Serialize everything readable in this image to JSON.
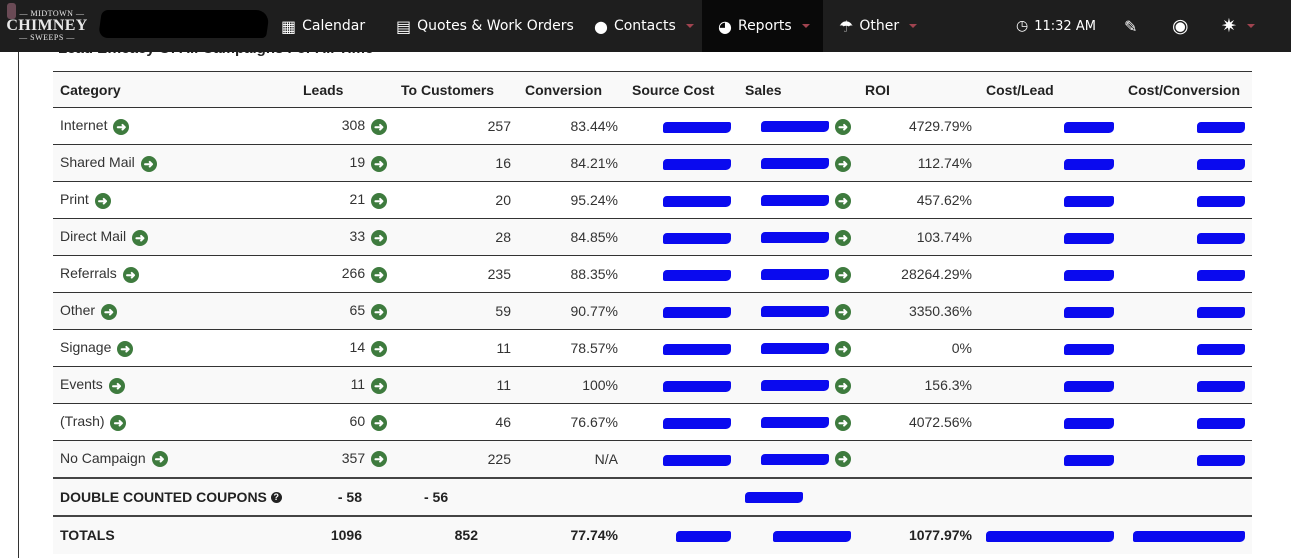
{
  "nav": {
    "logo": {
      "line1": "— MIDTOWN —",
      "line2": "CHIMNEY",
      "line3": "— SWEEPS —"
    },
    "items": [
      {
        "label": "Calendar",
        "icon": "calendar-icon",
        "glyph": "▦",
        "dropdown": false
      },
      {
        "label": "Quotes & Work Orders",
        "icon": "book-icon",
        "glyph": "▤",
        "dropdown": false
      },
      {
        "label": "Contacts",
        "icon": "user-icon",
        "glyph": "●",
        "dropdown": true
      },
      {
        "label": "Reports",
        "icon": "pie-chart-icon",
        "glyph": "◕",
        "dropdown": true,
        "active": true
      },
      {
        "label": "Other",
        "icon": "umbrella-icon",
        "glyph": "☂",
        "dropdown": true
      }
    ],
    "time": "11:32 AM",
    "clock_glyph": "◷",
    "edit_glyph": "✎",
    "globe_glyph": "◉",
    "gear_glyph": "✷"
  },
  "report": {
    "title": "Lead Efficacy Of All Campaigns For All Time",
    "columns": [
      "Category",
      "Leads",
      "To Customers",
      "Conversion",
      "Source Cost",
      "Sales",
      "ROI",
      "Cost/Lead",
      "Cost/Conversion"
    ],
    "rows": [
      {
        "category": "Internet",
        "leads": "308",
        "customers": "257",
        "conversion": "83.44%",
        "roi": "4729.79%"
      },
      {
        "category": "Shared Mail",
        "leads": "19",
        "customers": "16",
        "conversion": "84.21%",
        "roi": "112.74%"
      },
      {
        "category": "Print",
        "leads": "21",
        "customers": "20",
        "conversion": "95.24%",
        "roi": "457.62%"
      },
      {
        "category": "Direct Mail",
        "leads": "33",
        "customers": "28",
        "conversion": "84.85%",
        "roi": "103.74%"
      },
      {
        "category": "Referrals",
        "leads": "266",
        "customers": "235",
        "conversion": "88.35%",
        "roi": "28264.29%"
      },
      {
        "category": "Other",
        "leads": "65",
        "customers": "59",
        "conversion": "90.77%",
        "roi": "3350.36%"
      },
      {
        "category": "Signage",
        "leads": "14",
        "customers": "11",
        "conversion": "78.57%",
        "roi": "0%"
      },
      {
        "category": "Events",
        "leads": "11",
        "customers": "11",
        "conversion": "100%",
        "roi": "156.3%"
      },
      {
        "category": "(Trash)",
        "leads": "60",
        "customers": "46",
        "conversion": "76.67%",
        "roi": "4072.56%"
      },
      {
        "category": "No Campaign",
        "leads": "357",
        "customers": "225",
        "conversion": "N/A",
        "roi": ""
      }
    ],
    "double_counted": {
      "label": "DOUBLE COUNTED COUPONS",
      "leads": "- 58",
      "customers": "- 56"
    },
    "totals": {
      "label": "TOTALS",
      "leads": "1096",
      "customers": "852",
      "conversion": "77.74%",
      "roi": "1077.97%"
    },
    "colors": {
      "arrow": "#3e7b3e",
      "redaction": "#0a0aef",
      "navbar": "#1e1e1e",
      "caret": "#a0434f"
    }
  }
}
